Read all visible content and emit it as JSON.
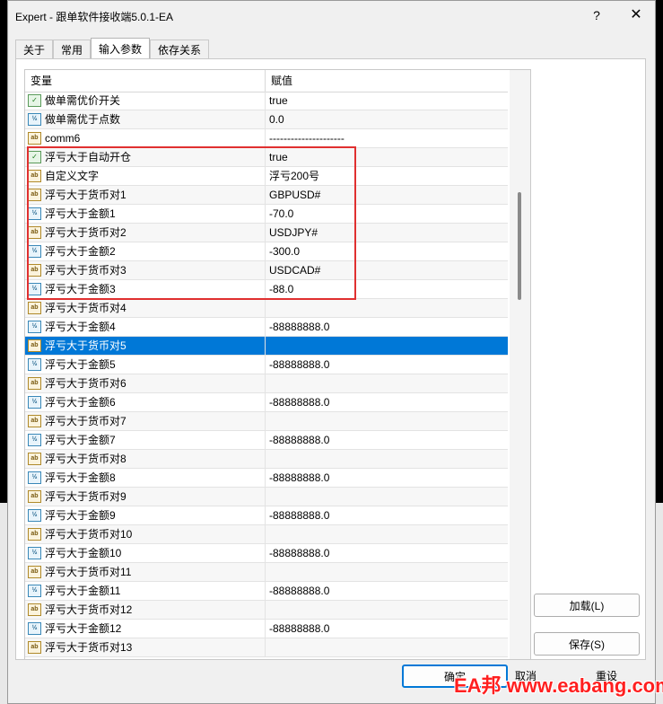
{
  "window": {
    "title": "Expert - 跟单软件接收端5.0.1-EA",
    "help": "?",
    "close": "✕"
  },
  "tabs": [
    {
      "label": "关于",
      "active": false
    },
    {
      "label": "常用",
      "active": false
    },
    {
      "label": "输入参数",
      "active": true
    },
    {
      "label": "依存关系",
      "active": false
    }
  ],
  "grid": {
    "col_variable": "变量",
    "col_value": "赋值",
    "rows": [
      {
        "icon": "bool-icon",
        "name": "做单需优价开关",
        "value": "true"
      },
      {
        "icon": "number-icon",
        "name": "做单需优于点数",
        "value": "0.0"
      },
      {
        "icon": "string-icon",
        "name": "comm6",
        "value": "---------------------"
      },
      {
        "icon": "bool-icon",
        "name": "浮亏大于自动开仓",
        "value": "true"
      },
      {
        "icon": "string-icon",
        "name": "自定义文字",
        "value": "浮亏200号"
      },
      {
        "icon": "string-icon",
        "name": "浮亏大于货币对1",
        "value": "GBPUSD#"
      },
      {
        "icon": "number-icon",
        "name": "浮亏大于金额1",
        "value": "-70.0"
      },
      {
        "icon": "string-icon",
        "name": "浮亏大于货币对2",
        "value": "USDJPY#"
      },
      {
        "icon": "number-icon",
        "name": "浮亏大于金额2",
        "value": "-300.0"
      },
      {
        "icon": "string-icon",
        "name": "浮亏大于货币对3",
        "value": "USDCAD#"
      },
      {
        "icon": "number-icon",
        "name": "浮亏大于金额3",
        "value": "-88.0"
      },
      {
        "icon": "string-icon",
        "name": "浮亏大于货币对4",
        "value": ""
      },
      {
        "icon": "number-icon",
        "name": "浮亏大于金额4",
        "value": "-88888888.0"
      },
      {
        "icon": "string-icon",
        "name": "浮亏大于货币对5",
        "value": "",
        "selected": true
      },
      {
        "icon": "number-icon",
        "name": "浮亏大于金额5",
        "value": "-88888888.0"
      },
      {
        "icon": "string-icon",
        "name": "浮亏大于货币对6",
        "value": ""
      },
      {
        "icon": "number-icon",
        "name": "浮亏大于金额6",
        "value": "-88888888.0"
      },
      {
        "icon": "string-icon",
        "name": "浮亏大于货币对7",
        "value": ""
      },
      {
        "icon": "number-icon",
        "name": "浮亏大于金额7",
        "value": "-88888888.0"
      },
      {
        "icon": "string-icon",
        "name": "浮亏大于货币对8",
        "value": ""
      },
      {
        "icon": "number-icon",
        "name": "浮亏大于金额8",
        "value": "-88888888.0"
      },
      {
        "icon": "string-icon",
        "name": "浮亏大于货币对9",
        "value": ""
      },
      {
        "icon": "number-icon",
        "name": "浮亏大于金额9",
        "value": "-88888888.0"
      },
      {
        "icon": "string-icon",
        "name": "浮亏大于货币对10",
        "value": ""
      },
      {
        "icon": "number-icon",
        "name": "浮亏大于金额10",
        "value": "-88888888.0"
      },
      {
        "icon": "string-icon",
        "name": "浮亏大于货币对11",
        "value": ""
      },
      {
        "icon": "number-icon",
        "name": "浮亏大于金额11",
        "value": "-88888888.0"
      },
      {
        "icon": "string-icon",
        "name": "浮亏大于货币对12",
        "value": ""
      },
      {
        "icon": "number-icon",
        "name": "浮亏大于金额12",
        "value": "-88888888.0"
      },
      {
        "icon": "string-icon",
        "name": "浮亏大于货币对13",
        "value": ""
      }
    ]
  },
  "buttons": {
    "load": "加载(L)",
    "save": "保存(S)",
    "ok": "确定",
    "cancel": "取消",
    "reset": "重设"
  },
  "watermark": "EA邦 www.eabang.com",
  "colors": {
    "selection": "#0078d7",
    "highlight_box": "#e03030"
  }
}
